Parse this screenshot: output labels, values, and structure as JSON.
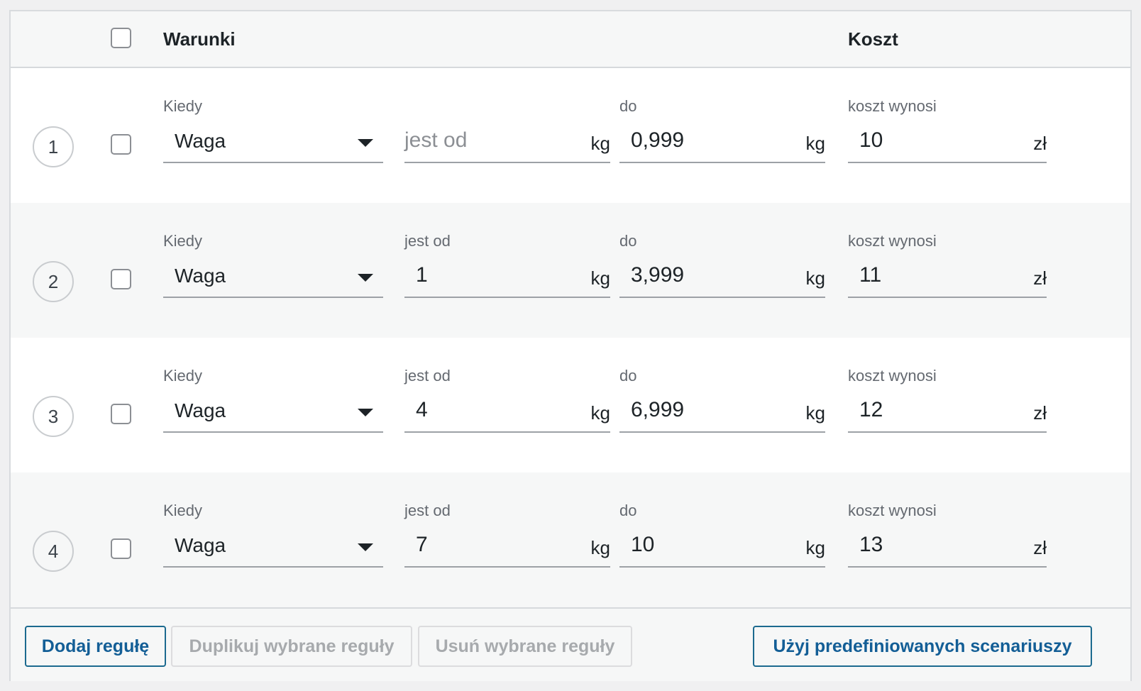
{
  "header": {
    "conditions_label": "Warunki",
    "cost_label": "Koszt"
  },
  "labels": {
    "when": "Kiedy",
    "from": "jest od",
    "to": "do",
    "cost": "koszt wynosi"
  },
  "units": {
    "weight": "kg",
    "currency": "zł"
  },
  "rules": [
    {
      "number": "1",
      "condition": "Waga",
      "from": "",
      "from_placeholder": "jest od",
      "to": "0,999",
      "cost": "10"
    },
    {
      "number": "2",
      "condition": "Waga",
      "from": "1",
      "to": "3,999",
      "cost": "11"
    },
    {
      "number": "3",
      "condition": "Waga",
      "from": "4",
      "to": "6,999",
      "cost": "12"
    },
    {
      "number": "4",
      "condition": "Waga",
      "from": "7",
      "to": "10",
      "cost": "13"
    }
  ],
  "footer": {
    "add_rule": "Dodaj regułę",
    "duplicate_selected": "Duplikuj wybrane reguły",
    "delete_selected": "Usuń wybrane reguły",
    "use_scenarios": "Użyj predefiniowanych scenariuszy"
  },
  "colors": {
    "primary_button": "#135e96",
    "disabled_text": "#a7aaad",
    "alt_row_bg": "#f6f7f7"
  }
}
